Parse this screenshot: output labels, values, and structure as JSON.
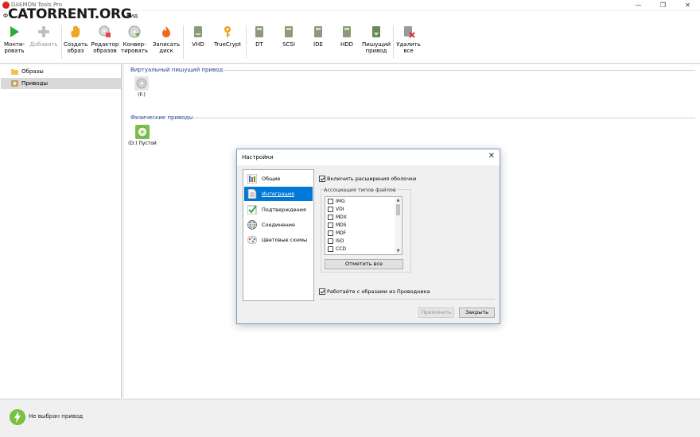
{
  "window": {
    "title": "DAEMON Tools Pro",
    "controls": [
      "—",
      "❐",
      "✕"
    ]
  },
  "watermark": "CATORRENT.ORG",
  "menu": {
    "items": [
      "Ф",
      "Вид"
    ]
  },
  "toolbar": {
    "buttons": [
      {
        "label1": "Монти-",
        "label2": "ровать",
        "icon": "play-icon",
        "color": "#2eaa3c"
      },
      {
        "label1": "Добавить",
        "label2": "",
        "icon": "plus-icon",
        "color": "#b5b5b5",
        "disabled": true
      },
      {
        "label1": "Создать",
        "label2": "образ",
        "icon": "hand-icon",
        "color": "#f2a51e"
      },
      {
        "label1": "Редактор",
        "label2": "образов",
        "icon": "image-editor-icon",
        "color": "#888888"
      },
      {
        "label1": "Конвер-",
        "label2": "тировать",
        "icon": "convert-icon",
        "color": "#6bb33f"
      },
      {
        "label1": "Записать",
        "label2": "диск",
        "icon": "burn-icon",
        "color": "#f06a1e"
      },
      {
        "label1": "VHD",
        "label2": "",
        "icon": "vhd-icon",
        "color": "#8a9a7a"
      },
      {
        "label1": "TrueCrypt",
        "label2": "",
        "icon": "key-icon",
        "color": "#f0a020"
      },
      {
        "label1": "DT",
        "label2": "",
        "icon": "dt-drive-icon",
        "color": "#8a9a7a"
      },
      {
        "label1": "SCSI",
        "label2": "",
        "icon": "scsi-drive-icon",
        "color": "#8a9a7a"
      },
      {
        "label1": "IDE",
        "label2": "",
        "icon": "ide-drive-icon",
        "color": "#8a9a7a"
      },
      {
        "label1": "HDD",
        "label2": "",
        "icon": "hdd-icon",
        "color": "#8a9a7a"
      },
      {
        "label1": "Пишущий",
        "label2": "привод",
        "icon": "writer-drive-icon",
        "color": "#6a8a5a"
      },
      {
        "label1": "Удалить",
        "label2": "все",
        "icon": "remove-all-icon",
        "color": "#d9302a"
      }
    ]
  },
  "sidebar": {
    "items": [
      {
        "label": "Образы",
        "icon": "folder-icon"
      },
      {
        "label": "Приводы",
        "icon": "drives-icon",
        "selected": true
      }
    ]
  },
  "main": {
    "virtual_title": "Виртуальный пишущий привод",
    "virtual_drive": "(F:)",
    "physical_title": "Физические приводы",
    "physical_drive": "(D:) Пустой"
  },
  "status": {
    "text": "Не выбран привод"
  },
  "dialog": {
    "title": "Настройки",
    "close": "✕",
    "categories": [
      {
        "label": "Общие",
        "icon": "general-icon"
      },
      {
        "label": "Интеграция",
        "icon": "integration-icon",
        "selected": true
      },
      {
        "label": "Подтверждения",
        "icon": "confirm-icon"
      },
      {
        "label": "Соединение",
        "icon": "connection-icon"
      },
      {
        "label": "Цветовые схемы",
        "icon": "color-scheme-icon"
      }
    ],
    "shell_ext_label": "Включить расширения оболочки",
    "shell_ext_checked": true,
    "assoc_title": "Ассоциация типов файлов",
    "file_types": [
      "IMG",
      "VDI",
      "MDX",
      "MDS",
      "MDF",
      "ISO",
      "CCD"
    ],
    "select_all": "Отметить все",
    "explorer_label": "Работайте с образами из Проводника",
    "explorer_checked": true,
    "apply": "Применить",
    "close_btn": "Закрыть"
  }
}
